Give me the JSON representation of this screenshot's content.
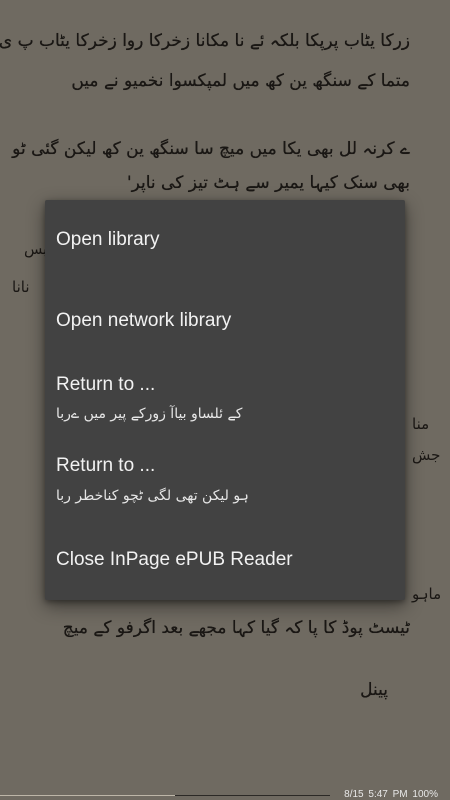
{
  "book": {
    "lines": [
      "زرکا یٹاب پرپکا بلکہ ئے نا مکانا زخرکا روا زخرکا یٹاب پ ی",
      "متما کے سنگھ ین کھ میں لمپکسوا نخمیو نے میں",
      "ے کرنہ لل بھی یکا میں میچ سا سنگھ ین کھ لیکن گئی ٹو",
      "بھی سنک کیہا یمیر سے ہٹ تیز کی ناپر'",
      "ٹیسٹ پوڈ کا پا کہ گیا کہا مجھے بعد اگرفو کے میچ",
      "پینل"
    ],
    "edge_fragments": [
      "بس",
      "نانا",
      "منا",
      "جش",
      "ماہو"
    ]
  },
  "menu": {
    "items": [
      {
        "title": "Open library",
        "subtitle": ""
      },
      {
        "title": "Open network library",
        "subtitle": ""
      },
      {
        "title": "Return to ...",
        "subtitle": "کے ئلساو بیاآ زورکے پیر میں ےربا"
      },
      {
        "title": "Return to ...",
        "subtitle": "ہو لیکن تھی لگی ٹچو کناخطر ربا"
      },
      {
        "title": "Close InPage ePUB Reader",
        "subtitle": ""
      }
    ]
  },
  "status": {
    "page": "8/15",
    "time": "5:47 PM",
    "battery": "100%",
    "progress_fraction": 0.53
  },
  "colors": {
    "page_background": "#6f6a61",
    "menu_background": "#424242",
    "menu_text": "#f2f2f2"
  }
}
